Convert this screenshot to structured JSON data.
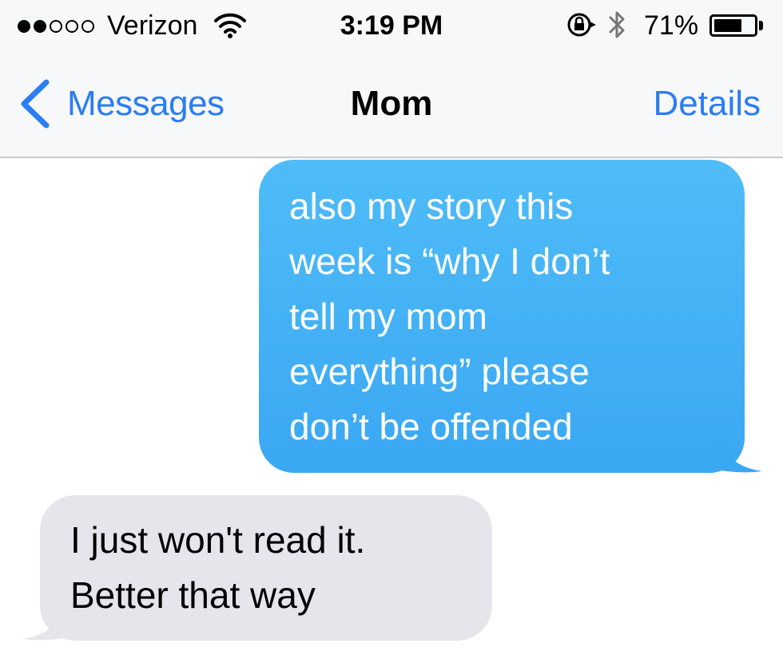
{
  "status_bar": {
    "carrier": "Verizon",
    "signal_strength": 2,
    "signal_max": 5,
    "time": "3:19 PM",
    "battery_percent_label": "71%",
    "battery_level": 0.71,
    "icons": [
      "wifi-icon",
      "rotation-lock-icon",
      "bluetooth-icon",
      "battery-icon"
    ]
  },
  "nav": {
    "back_label": "Messages",
    "title": "Mom",
    "details_label": "Details",
    "back_icon": "chevron-left-icon"
  },
  "colors": {
    "accent": "#2a7df4",
    "outgoing_bubble": "#41b0f6",
    "incoming_bubble": "#e6e5eb"
  },
  "messages": [
    {
      "direction": "outgoing",
      "lines": [
        "also my story this",
        "week is “why I don’t",
        "tell my mom",
        "everything” please",
        "don’t be offended"
      ]
    },
    {
      "direction": "incoming",
      "lines": [
        "I just won't read it.",
        "Better that way"
      ]
    }
  ]
}
